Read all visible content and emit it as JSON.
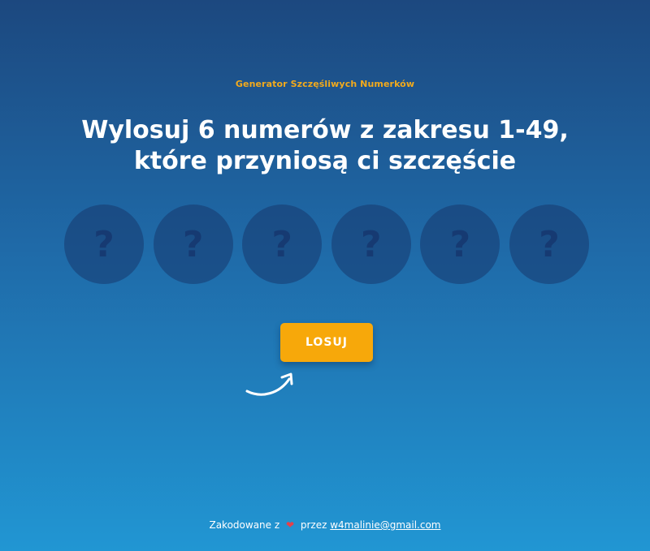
{
  "header": {
    "eyebrow": "Generator Szczęśliwych Numerków",
    "title_line1": "Wylosuj 6 numerów z zakresu 1-49,",
    "title_line2": "które przyniosą ci szczęście"
  },
  "balls": [
    "?",
    "?",
    "?",
    "?",
    "?",
    "?"
  ],
  "draw_button": {
    "label": "LOSUJ"
  },
  "footer": {
    "prefix": "Zakodowane z",
    "heart": "❤",
    "middle": "przez",
    "email": "w4malinie@gmail.com"
  },
  "colors": {
    "accent": "#f7a80a",
    "eyebrow": "#f2aa1c",
    "bg_top": "#1c487f",
    "bg_bottom": "#2196d3",
    "ball": "#163a72"
  }
}
